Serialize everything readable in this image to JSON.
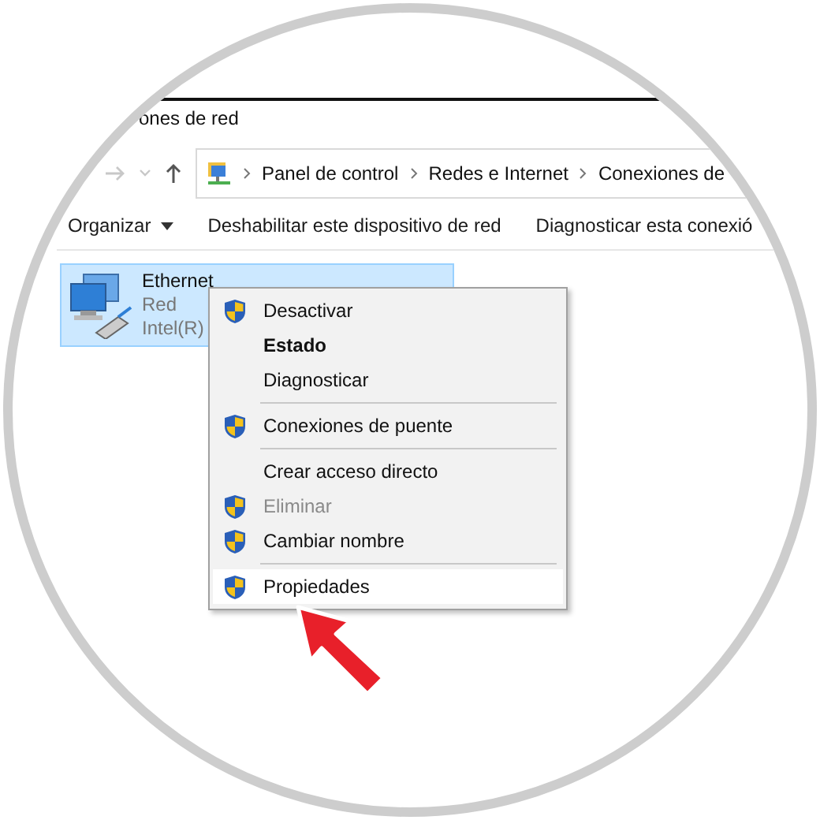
{
  "window": {
    "title": "ones de red"
  },
  "address_bar": {
    "crumbs": [
      "Panel de control",
      "Redes e Internet",
      "Conexiones de"
    ]
  },
  "toolbar": {
    "items": [
      {
        "label": "Organizar",
        "dropdown": true
      },
      {
        "label": "Deshabilitar este dispositivo de red",
        "dropdown": false
      },
      {
        "label": "Diagnosticar esta conexió",
        "dropdown": false
      }
    ]
  },
  "connection": {
    "name": "Ethernet",
    "network": "Red",
    "adapter": "Intel(R)",
    "selected": true
  },
  "context_menu": {
    "items": [
      {
        "kind": "item",
        "label": "Desactivar",
        "shield": true,
        "bold": false,
        "disabled": false,
        "selected": false
      },
      {
        "kind": "item",
        "label": "Estado",
        "shield": false,
        "bold": true,
        "disabled": false,
        "selected": false
      },
      {
        "kind": "item",
        "label": "Diagnosticar",
        "shield": false,
        "bold": false,
        "disabled": false,
        "selected": false
      },
      {
        "kind": "separator"
      },
      {
        "kind": "item",
        "label": "Conexiones de puente",
        "shield": true,
        "bold": false,
        "disabled": false,
        "selected": false
      },
      {
        "kind": "separator"
      },
      {
        "kind": "item",
        "label": "Crear acceso directo",
        "shield": false,
        "bold": false,
        "disabled": false,
        "selected": false
      },
      {
        "kind": "item",
        "label": "Eliminar",
        "shield": true,
        "bold": false,
        "disabled": true,
        "selected": false
      },
      {
        "kind": "item",
        "label": "Cambiar nombre",
        "shield": true,
        "bold": false,
        "disabled": false,
        "selected": false
      },
      {
        "kind": "separator"
      },
      {
        "kind": "item",
        "label": "Propiedades",
        "shield": true,
        "bold": false,
        "disabled": false,
        "selected": true
      }
    ]
  }
}
